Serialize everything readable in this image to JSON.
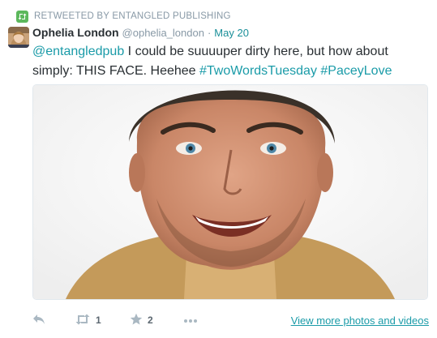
{
  "retweet_context": {
    "label": "RETWEETED BY ENTANGLED PUBLISHING",
    "icon": "retweet-icon",
    "color": "#5cb85c"
  },
  "tweet": {
    "author_name": "Ophelia London",
    "username": "@ophelia_london",
    "separator": "·",
    "timestamp": "May 20",
    "mention": "@entangledpub",
    "body": " I could be suuuuper dirty here, but how about simply: THIS FACE. Heehee ",
    "hashtag_1": "#TwoWordsTuesday",
    "hashtag_2": "#PaceyLove",
    "link_color": "#1a9ba8"
  },
  "actions": {
    "reply_icon": "reply-icon",
    "retweet_icon": "retweet-icon",
    "retweet_count": "1",
    "favorite_icon": "star-icon",
    "favorite_count": "2",
    "more_icon": "more-icon",
    "view_more": "View more photos and videos"
  }
}
